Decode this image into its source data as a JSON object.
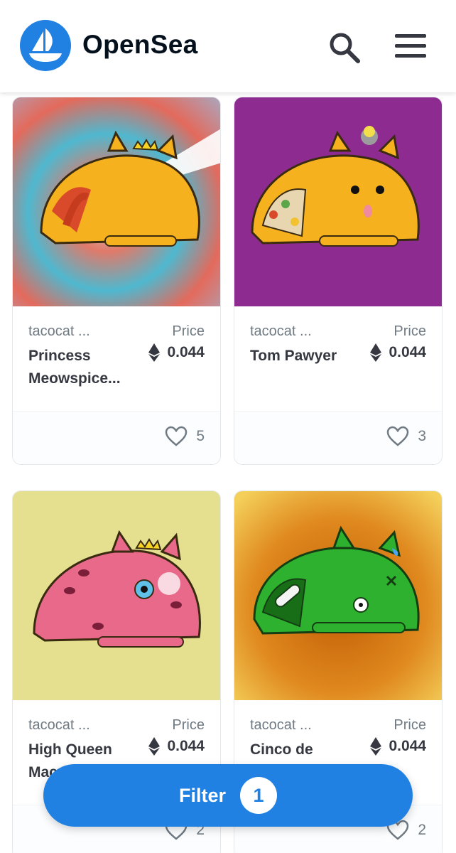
{
  "header": {
    "brand": "OpenSea",
    "logo_icon": "opensea-logo-icon",
    "search_icon": "search-icon",
    "menu_icon": "hamburger-menu-icon",
    "brand_color": "#2081e2"
  },
  "cards": [
    {
      "collection": "tacocat ...",
      "name": "Princess Meowspice...",
      "price_label": "Price",
      "price": "0.044",
      "likes": "5",
      "bg": "swirl-red-blue-gray"
    },
    {
      "collection": "tacocat ...",
      "name": "Tom Pawyer",
      "price_label": "Price",
      "price": "0.044",
      "likes": "3",
      "bg": "#8e2b91"
    },
    {
      "collection": "tacocat ...",
      "name": "High Queen Mac...",
      "price_label": "Price",
      "price": "0.044",
      "likes": "2",
      "bg": "#e4e08f"
    },
    {
      "collection": "tacocat ...",
      "name": "Cinco de",
      "price_label": "Price",
      "price": "0.044",
      "likes": "2",
      "bg": "#e8a53a"
    }
  ],
  "filter": {
    "label": "Filter",
    "count": "1"
  }
}
